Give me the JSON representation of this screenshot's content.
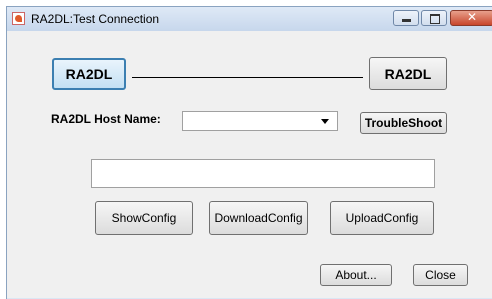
{
  "window": {
    "title": "RA2DL:Test Connection"
  },
  "connection": {
    "left_node_label": "RA2DL",
    "right_node_label": "RA2DL"
  },
  "host": {
    "label": "RA2DL Host Name:",
    "value": "",
    "troubleshoot_label": "TroubleShoot"
  },
  "output": {
    "value": ""
  },
  "actions": {
    "show_config": "ShowConfig",
    "download_config": "DownloadConfig",
    "upload_config": "UploadConfig"
  },
  "footer": {
    "about": "About...",
    "close": "Close"
  }
}
